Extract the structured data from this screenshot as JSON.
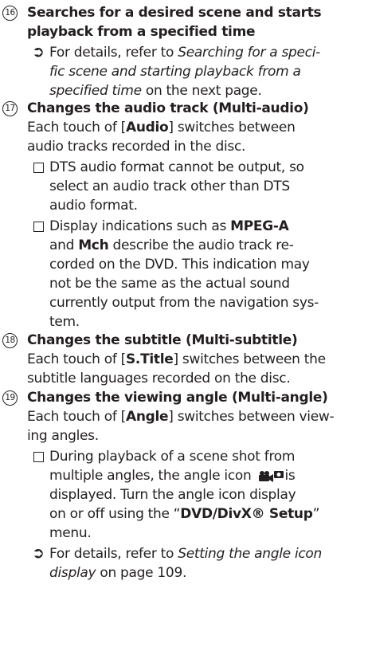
{
  "items": [
    {
      "number": "16",
      "heading": [
        "Searches for a desired scene and starts",
        "playback from a specified time"
      ],
      "refer": {
        "prefix": "For details, refer to ",
        "link_lines": [
          "Searching for a speci-",
          "fic scene and starting playback from a",
          "specified time"
        ],
        "suffix": " on the next page."
      }
    },
    {
      "number": "17",
      "heading": [
        "Changes the audio track (Multi-audio)"
      ],
      "body": {
        "pre": "Each touch of [",
        "key": "Audio",
        "post": "] switches between",
        "line2": "audio tracks recorded in the disc."
      },
      "note1": [
        "DTS audio format cannot be output, so",
        "select an audio track other than DTS",
        "audio format."
      ],
      "note2": {
        "l1_pre": "Display indications such as ",
        "l1_key": "MPEG-A",
        "l2_pre": "and ",
        "l2_key": "Mch",
        "l2_post": " describe the audio track re-",
        "lines": [
          "corded on the DVD. This indication may",
          "not be the same as the actual sound",
          "currently output from the navigation sys-",
          "tem."
        ]
      }
    },
    {
      "number": "18",
      "heading": [
        "Changes the subtitle (Multi-subtitle)"
      ],
      "body": {
        "pre": "Each touch of [",
        "key": "S.Title",
        "post": "] switches between the",
        "line2": "subtitle languages recorded on the disc."
      }
    },
    {
      "number": "19",
      "heading": [
        "Changes the viewing angle (Multi-angle)"
      ],
      "body": {
        "pre": "Each touch of [",
        "key": "Angle",
        "post": "] switches between view-",
        "line2": "ing angles."
      },
      "note": {
        "l1": "During playback of a scene shot from",
        "l2_pre": "multiple angles, the angle icon",
        "l2_post": "is",
        "l3": "displayed. Turn the angle icon display",
        "l4_pre": "on or off using the “",
        "l4_key": "DVD/DivX® Setup",
        "l4_post": "”",
        "l5": "menu."
      },
      "refer": {
        "prefix": "For details, refer to ",
        "link_l1": "Setting the angle icon",
        "link_l2": "display",
        "suffix": " on page 109."
      }
    }
  ]
}
